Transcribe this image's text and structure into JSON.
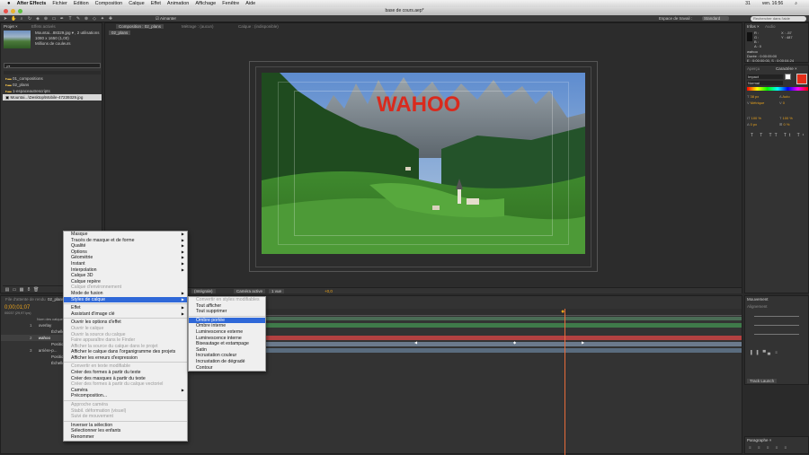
{
  "menubar": {
    "app": "After Effects",
    "items": [
      "Fichier",
      "Edition",
      "Composition",
      "Calque",
      "Effet",
      "Animation",
      "Affichage",
      "Fenêtre",
      "Aide"
    ],
    "clock": "ven. 16:56",
    "battery": "31"
  },
  "window": {
    "title": "base de cours.aep*"
  },
  "toolbar": {
    "snap_label": "Aimanter",
    "workspace_label": "Espace de travail :",
    "workspace_value": "Standard",
    "search_placeholder": "Rechercher dans l'aide"
  },
  "project": {
    "tab": "Projet ×",
    "tab2": "Effets activés",
    "asset_name": "Mountai...88329.jpg ▾ , 2 utilisations",
    "asset_dims": "1080 x 1650 (1,00)",
    "asset_colors": "Millions de couleurs",
    "search_placeholder": "ρ▾",
    "items": [
      "01_compositions",
      "02_plans",
      "1-espaceautrescripts",
      "Mountai...\\Desktop\\Mobile-47239329.jpg"
    ]
  },
  "comp": {
    "tab": "Composition : 02_plans",
    "tab2": "Métrage : (aucun)",
    "tab3": "Calque : (indisponible)",
    "subtab": "02_plans",
    "overlay_text": "WAHOO",
    "bottom_zoom": "(Intégrale)",
    "bottom_camera": "Caméra active",
    "bottom_views": "1 vue",
    "bottom_offset": "+0,0"
  },
  "info": {
    "tab": "Infos ×",
    "tab2": "Audio",
    "r": "R :",
    "g": "G :",
    "b": "B :",
    "a": "A : 0",
    "x": "X : -57",
    "y": "Y : 487",
    "layer": "wahoo",
    "duration": "Durée : 0:00:05:00",
    "inout": "E : 0:00:00:00, S : 0:00:04:24"
  },
  "character": {
    "tab": "Aperçu",
    "tab2": "Caractère ×",
    "font": "Impact",
    "style": "Normal",
    "size": "38 px",
    "leading": "Auto",
    "kerning": "Métrique",
    "tracking": "0",
    "vscale": "100 %",
    "hscale": "100 %",
    "baseline": "0 px",
    "tsume": "0 %"
  },
  "timeline": {
    "tab": "02_plans ×",
    "tab2": "File d'attente de rendu",
    "time": "0;00;01;07",
    "fps": "00037 (29,97 ips)",
    "col_name": "Nom des calques",
    "layers": [
      {
        "num": "1",
        "name": "overlay"
      },
      {
        "num": "",
        "name": "Échelle"
      },
      {
        "num": "2",
        "name": "wahoo"
      },
      {
        "num": "",
        "name": "Position"
      },
      {
        "num": "3",
        "name": "arrière-p..."
      },
      {
        "num": "",
        "name": "Position"
      },
      {
        "num": "",
        "name": "Échelle"
      }
    ]
  },
  "right_lower": {
    "tab": "Mouvement",
    "tab2": "Alignement",
    "tracker_label": "Track Launch",
    "paragraph": "Paragraphe ×"
  },
  "context_menu": {
    "items": [
      {
        "label": "Masque",
        "sub": true
      },
      {
        "label": "Tracés de masque et de forme",
        "sub": true
      },
      {
        "label": "Qualité",
        "sub": true
      },
      {
        "label": "Options",
        "sub": true
      },
      {
        "label": "Géométrie",
        "sub": true
      },
      {
        "label": "Instant",
        "sub": true
      },
      {
        "label": "Interpolation",
        "sub": true
      },
      {
        "label": "Calque 3D"
      },
      {
        "label": "Calque repère"
      },
      {
        "label": "Calque d'environnement",
        "dis": true
      },
      {
        "label": "Mode de fusion",
        "sub": true
      },
      {
        "label": "Styles de calque",
        "sub": true,
        "hl": true
      },
      {
        "sep": true
      },
      {
        "label": "Effet",
        "sub": true
      },
      {
        "label": "Assistant d'image clé",
        "sub": true
      },
      {
        "sep": true
      },
      {
        "label": "Ouvrir les options d'effet"
      },
      {
        "label": "Ouvrir le calque",
        "dis": true
      },
      {
        "label": "Ouvrir la source du calque",
        "dis": true
      },
      {
        "label": "Faire apparaître dans le Finder",
        "dis": true
      },
      {
        "label": "Afficher la source du calque dans le projet",
        "dis": true
      },
      {
        "label": "Afficher le calque dans l'organigramme des projets"
      },
      {
        "label": "Afficher les erreurs d'expression"
      },
      {
        "sep": true
      },
      {
        "label": "Convertir en texte modifiable",
        "dis": true
      },
      {
        "label": "Créer des formes à partir du texte"
      },
      {
        "label": "Créer des masques à partir du texte"
      },
      {
        "label": "Créer des formes à partir du calque vectoriel",
        "dis": true
      },
      {
        "label": "Caméra",
        "sub": true
      },
      {
        "label": "Précomposition..."
      },
      {
        "sep": true
      },
      {
        "label": "Approche caméra",
        "dis": true
      },
      {
        "label": "Stabil. déformation (visuel)",
        "dis": true
      },
      {
        "label": "Suivi de mouvement",
        "dis": true
      },
      {
        "sep": true
      },
      {
        "label": "Inverser la sélection"
      },
      {
        "label": "Sélectionner les enfants"
      },
      {
        "label": "Renommer"
      }
    ]
  },
  "submenu": {
    "items": [
      {
        "label": "Convertir en styles modifiables",
        "dis": true
      },
      {
        "label": "Tout afficher"
      },
      {
        "label": "Tout supprimer"
      },
      {
        "sep": true
      },
      {
        "label": "Ombre portée",
        "hl": true
      },
      {
        "label": "Ombre interne"
      },
      {
        "label": "Luminescence externe"
      },
      {
        "label": "Luminescence interne"
      },
      {
        "label": "Biseautage et estampage"
      },
      {
        "label": "Satin"
      },
      {
        "label": "Incrustation couleur"
      },
      {
        "label": "Incrustation de dégradé"
      },
      {
        "label": "Contour"
      }
    ]
  },
  "colors": {
    "accent": "#2f68d8",
    "time": "#e8a21c",
    "wahoo": "#d92a1d"
  }
}
